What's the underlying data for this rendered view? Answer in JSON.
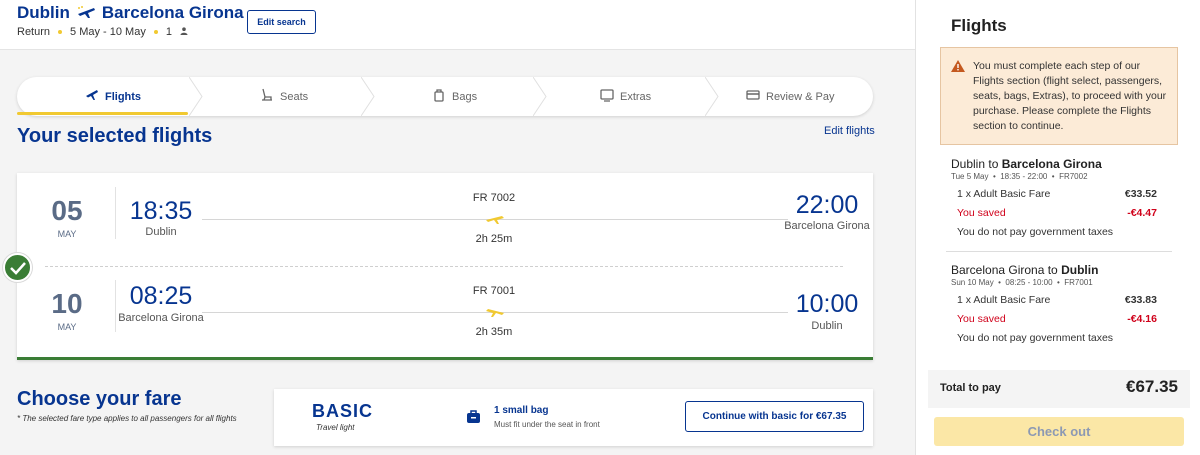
{
  "header": {
    "origin": "Dublin",
    "destination": "Barcelona Girona",
    "trip_type": "Return",
    "dates": "5 May - 10 May",
    "passengers": "1",
    "edit_search_label": "Edit search"
  },
  "steps": [
    {
      "label": "Flights",
      "icon": "plane-icon",
      "active": true
    },
    {
      "label": "Seats",
      "icon": "seat-icon",
      "active": false
    },
    {
      "label": "Bags",
      "icon": "bag-icon",
      "active": false
    },
    {
      "label": "Extras",
      "icon": "extras-icon",
      "active": false
    },
    {
      "label": "Review & Pay",
      "icon": "card-icon",
      "active": false
    }
  ],
  "selected": {
    "heading": "Your selected flights",
    "edit_label": "Edit flights",
    "flights": [
      {
        "day": "05",
        "month": "MAY",
        "dep_time": "18:35",
        "dep_city": "Dublin",
        "flight_no": "FR 7002",
        "duration": "2h 25m",
        "arr_time": "22:00",
        "arr_city": "Barcelona Girona"
      },
      {
        "day": "10",
        "month": "MAY",
        "dep_time": "08:25",
        "dep_city": "Barcelona Girona",
        "flight_no": "FR 7001",
        "duration": "2h 35m",
        "arr_time": "10:00",
        "arr_city": "Dublin"
      }
    ]
  },
  "fare": {
    "heading": "Choose your fare",
    "note": "* The selected fare type applies to all passengers for all flights",
    "name": "BASIC",
    "subtitle": "Travel light",
    "bag_title": "1 small bag",
    "bag_sub": "Must fit under the seat in front",
    "continue_label": "Continue with basic for €67.35"
  },
  "summary": {
    "title": "Flights",
    "warning": "You must complete each step of our Flights section (flight select, passengers, seats, bags, Extras), to proceed with your purchase. Please complete the Flights section to continue.",
    "segments": [
      {
        "from": "Dublin",
        "to": "Barcelona Girona",
        "from_bold": false,
        "date": "Tue 5 May",
        "times": "18:35 - 22:00",
        "flight": "FR7002",
        "fare_line": "1 x Adult Basic Fare",
        "fare_amount": "€33.52",
        "saved_label": "You saved",
        "saved_amount": "-€4.47",
        "tax_note": "You do not pay government taxes"
      },
      {
        "from": "Barcelona Girona",
        "to": "Dublin",
        "from_bold": false,
        "date": "Sun 10 May",
        "times": "08:25 - 10:00",
        "flight": "FR7001",
        "fare_line": "1 x Adult Basic Fare",
        "fare_amount": "€33.83",
        "saved_label": "You saved",
        "saved_amount": "-€4.16",
        "tax_note": "You do not pay government taxes"
      }
    ],
    "total_label": "Total to pay",
    "total_amount": "€67.35",
    "checkout_label": "Check out"
  },
  "colors": {
    "brand": "#073590",
    "accent": "#f1c931",
    "success": "#3a7d35",
    "saved": "#d0021b"
  }
}
